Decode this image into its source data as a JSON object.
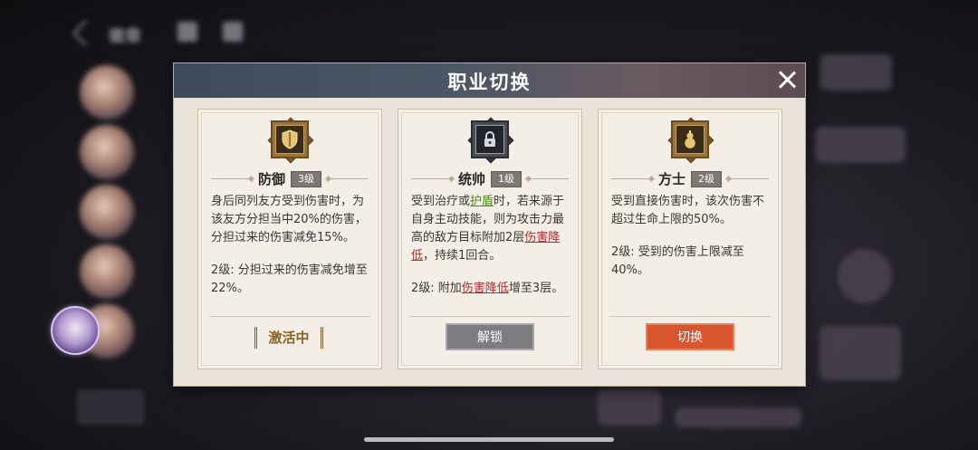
{
  "background": {
    "topbar_label": "徽章"
  },
  "modal": {
    "title": "职业切换",
    "cards": [
      {
        "icon": "shield-icon",
        "name": "防御",
        "level": "3级",
        "desc1": "身后同列友方受到伤害时，为该友方分担当中20%的伤害，分担过来的伤害减免15%。",
        "desc2": "2级: 分担过来的伤害减免增至22%。",
        "status": "激活中"
      },
      {
        "icon": "lock-icon",
        "name": "统帅",
        "level": "1级",
        "desc1_a": "受到治疗或",
        "desc1_kw1": "护盾",
        "desc1_b": "时，若来源于自身主动技能，则为攻击力最高的敌方目标附加2层",
        "desc1_kw2": "伤害降低",
        "desc1_c": "，持续1回合。",
        "desc2_a": "2级: 附加",
        "desc2_kw": "伤害降低",
        "desc2_b": "增至3层。",
        "button": "解锁"
      },
      {
        "icon": "gourd-icon",
        "name": "方士",
        "level": "2级",
        "desc1": "受到直接伤害时，该次伤害不超过生命上限的50%。",
        "desc2": "2级: 受到的伤害上限减至40%。",
        "button": "切换"
      }
    ]
  },
  "colors": {
    "switch_button": "#d9552d",
    "unlock_button": "#7e7c80",
    "keyword_green": "#4f8a22",
    "keyword_red": "#b52b2b"
  }
}
